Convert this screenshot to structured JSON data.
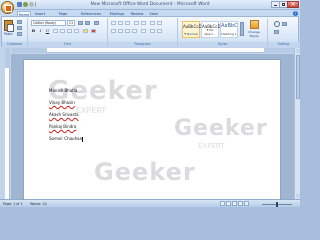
{
  "window": {
    "title": "New Microsoft Office Word Document - Microsoft Word"
  },
  "tabs": [
    {
      "label": "Home",
      "active": true
    },
    {
      "label": "Insert",
      "active": false
    },
    {
      "label": "Page Layout",
      "active": false
    },
    {
      "label": "References",
      "active": false
    },
    {
      "label": "Mailings",
      "active": false
    },
    {
      "label": "Review",
      "active": false
    },
    {
      "label": "View",
      "active": false
    }
  ],
  "ribbon": {
    "clipboard": {
      "paste_label": "Paste",
      "group_label": "Clipboard"
    },
    "font": {
      "font_name": "Calibri (Body)",
      "font_size": "11",
      "group_label": "Font",
      "bold": "B",
      "italic": "I",
      "underline": "U"
    },
    "paragraph": {
      "group_label": "Paragraph"
    },
    "styles": {
      "group_label": "Styles",
      "items": [
        {
          "sample": "AaBbCcDc",
          "name": "¶ Normal"
        },
        {
          "sample": "AaBbCcDc",
          "name": "¶ No Spaci..."
        },
        {
          "sample": "AaBbC",
          "name": "Heading 1"
        }
      ],
      "change_styles_label": "Change Styles"
    },
    "editing": {
      "group_label": "Editing"
    }
  },
  "document": {
    "lines": [
      {
        "text": "Manish Bhatia",
        "misspelled": false
      },
      {
        "text": "Vinay Bhasin",
        "misspelled": true
      },
      {
        "text": "Akash Srivasta",
        "misspelled": true
      },
      {
        "text": "Pankaj Bindra",
        "misspelled": true
      },
      {
        "text": "Somvir Chauhan",
        "misspelled": false
      }
    ],
    "watermark": {
      "brand": "Geeker",
      "sub": "EXPERT"
    }
  },
  "status_bar": {
    "page": "Page: 1 of 1",
    "words": "Words: 10"
  },
  "colors": {
    "ribbon_bg": "#dbe8f7",
    "title_text": "#3b4f6a",
    "tab_text": "#15428b",
    "spell_error": "#d02020"
  }
}
